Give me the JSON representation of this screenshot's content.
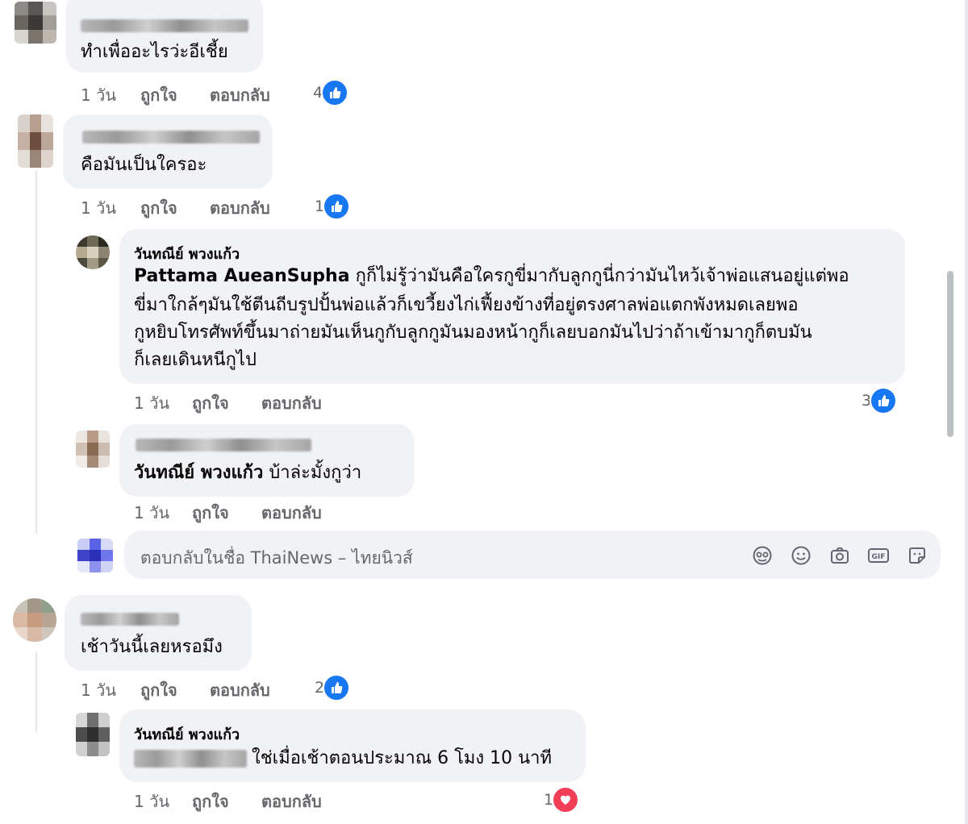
{
  "comments": [
    {
      "text": "ทำเพื่ออะไรว่ะอีเชี้ย",
      "time": "1 วัน",
      "like": "ถูกใจ",
      "reply": "ตอบกลับ",
      "reactions": "4"
    },
    {
      "text": "คือมันเป็นใครอะ",
      "time": "1 วัน",
      "like": "ถูกใจ",
      "reply": "ตอบกลับ",
      "reactions": "1"
    },
    {
      "author": "วันทณีย์ พวงแก้ว",
      "mention": "Pattama AueanSupha",
      "lines": [
        "กูก็ไม่รู้ว่ามันคือใครกูขี่มากับลูกกูนี่กว่ามันไหว้เจ้าพ่อแสนอยู่แต่พอ",
        "ขี่มาใกล้ๆมันใช้ตีนถีบรูปปั้นพ่อแล้วก็เขวี้ยงไก่เฟี้ยงข้างที่อยู่ตรงศาลพ่อแตกพังหมดเลยพอ",
        "กูหยิบโทรศัพท์ขึ้นมาถ่ายมันเห็นกูกับลูกกูมันมองหน้ากูก็เลยบอกมันไปว่าถ้าเข้ามากูก็ตบมัน",
        "ก็เลยเดินหนีกูไป"
      ],
      "time": "1 วัน",
      "like": "ถูกใจ",
      "reply": "ตอบกลับ",
      "reactions": "3"
    },
    {
      "mention": "วันทณีย์ พวงแก้ว",
      "text": "บ้าล่ะมั้งกูว่า",
      "time": "1 วัน",
      "like": "ถูกใจ",
      "reply": "ตอบกลับ"
    },
    {
      "text": "เช้าวันนี้เลยหรอมึง",
      "time": "1 วัน",
      "like": "ถูกใจ",
      "reply": "ตอบกลับ",
      "reactions": "2"
    },
    {
      "author": "วันทณีย์ พวงแก้ว",
      "text": "ใช่เมื่อเช้าตอนประมาณ 6 โมง 10 นาที",
      "time": "1 วัน",
      "like": "ถูกใจ",
      "reply": "ตอบกลับ",
      "reactions": "1"
    }
  ],
  "reply_box": {
    "placeholder": "ตอบกลับในชื่อ ThaiNews – ไทยนิวส์"
  },
  "icons": {
    "like": "like-icon",
    "love": "heart-icon",
    "avatar_sticker": "avatar-sticker-icon",
    "emoji": "emoji-icon",
    "camera": "camera-icon",
    "gif": "gif-icon",
    "sticker": "sticker-icon"
  },
  "colors": {
    "bubble": "#f0f2f5",
    "like_blue": "#1877f2",
    "love_red": "#f33e58",
    "meta_gray": "#65676b"
  }
}
